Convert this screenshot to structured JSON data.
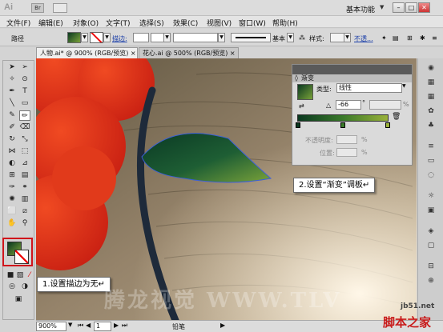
{
  "titlebar": {
    "logo": "Ai",
    "bridge_label": "Br",
    "workspace": "基本功能",
    "workspace_chevron": "▼",
    "minimize": "–",
    "restore": "□",
    "close": "✕"
  },
  "menubar": [
    "文件(F)",
    "编辑(E)",
    "对象(O)",
    "文字(T)",
    "选择(S)",
    "效果(C)",
    "视图(V)",
    "窗口(W)",
    "帮助(H)"
  ],
  "controlbar": {
    "selection_label": "路径",
    "stroke_label": "描边:",
    "style_preset": "基本",
    "style_label": "样式:",
    "opacity_label": "不透..."
  },
  "tabs": [
    {
      "label": "人物.ai* @ 900% (RGB/预览)",
      "close": "×"
    },
    {
      "label": "花心.ai @ 500% (RGB/预览)",
      "close": "×"
    }
  ],
  "gradient_panel": {
    "title": "渐变",
    "type_label": "类型:",
    "type_value": "线性",
    "angle_value": "-66",
    "angle_unit": "°",
    "percent": "%",
    "opacity_label": "不透明度:",
    "location_label": "位置:",
    "stop_colors": [
      "#0a3820",
      "#3a7a2a",
      "#9ab13a"
    ]
  },
  "callouts": {
    "stroke_none": "1.设置描边为无↵",
    "gradient_set": "2.设置“渐变”调板↵"
  },
  "statusbar": {
    "zoom": "900%",
    "artboard": "1",
    "tool_name": "铅笔"
  },
  "watermark": "腾龙视觉  WWW.TLV",
  "site_url": "jb51.net",
  "site_brand": "脚本之家",
  "colors": {
    "flower_red": "#e8321a",
    "leaf_dark": "#0b3a24",
    "leaf_light": "#7aa23a",
    "highlight_border": "#d0141b",
    "stem_dark": "#1e2a3a"
  }
}
